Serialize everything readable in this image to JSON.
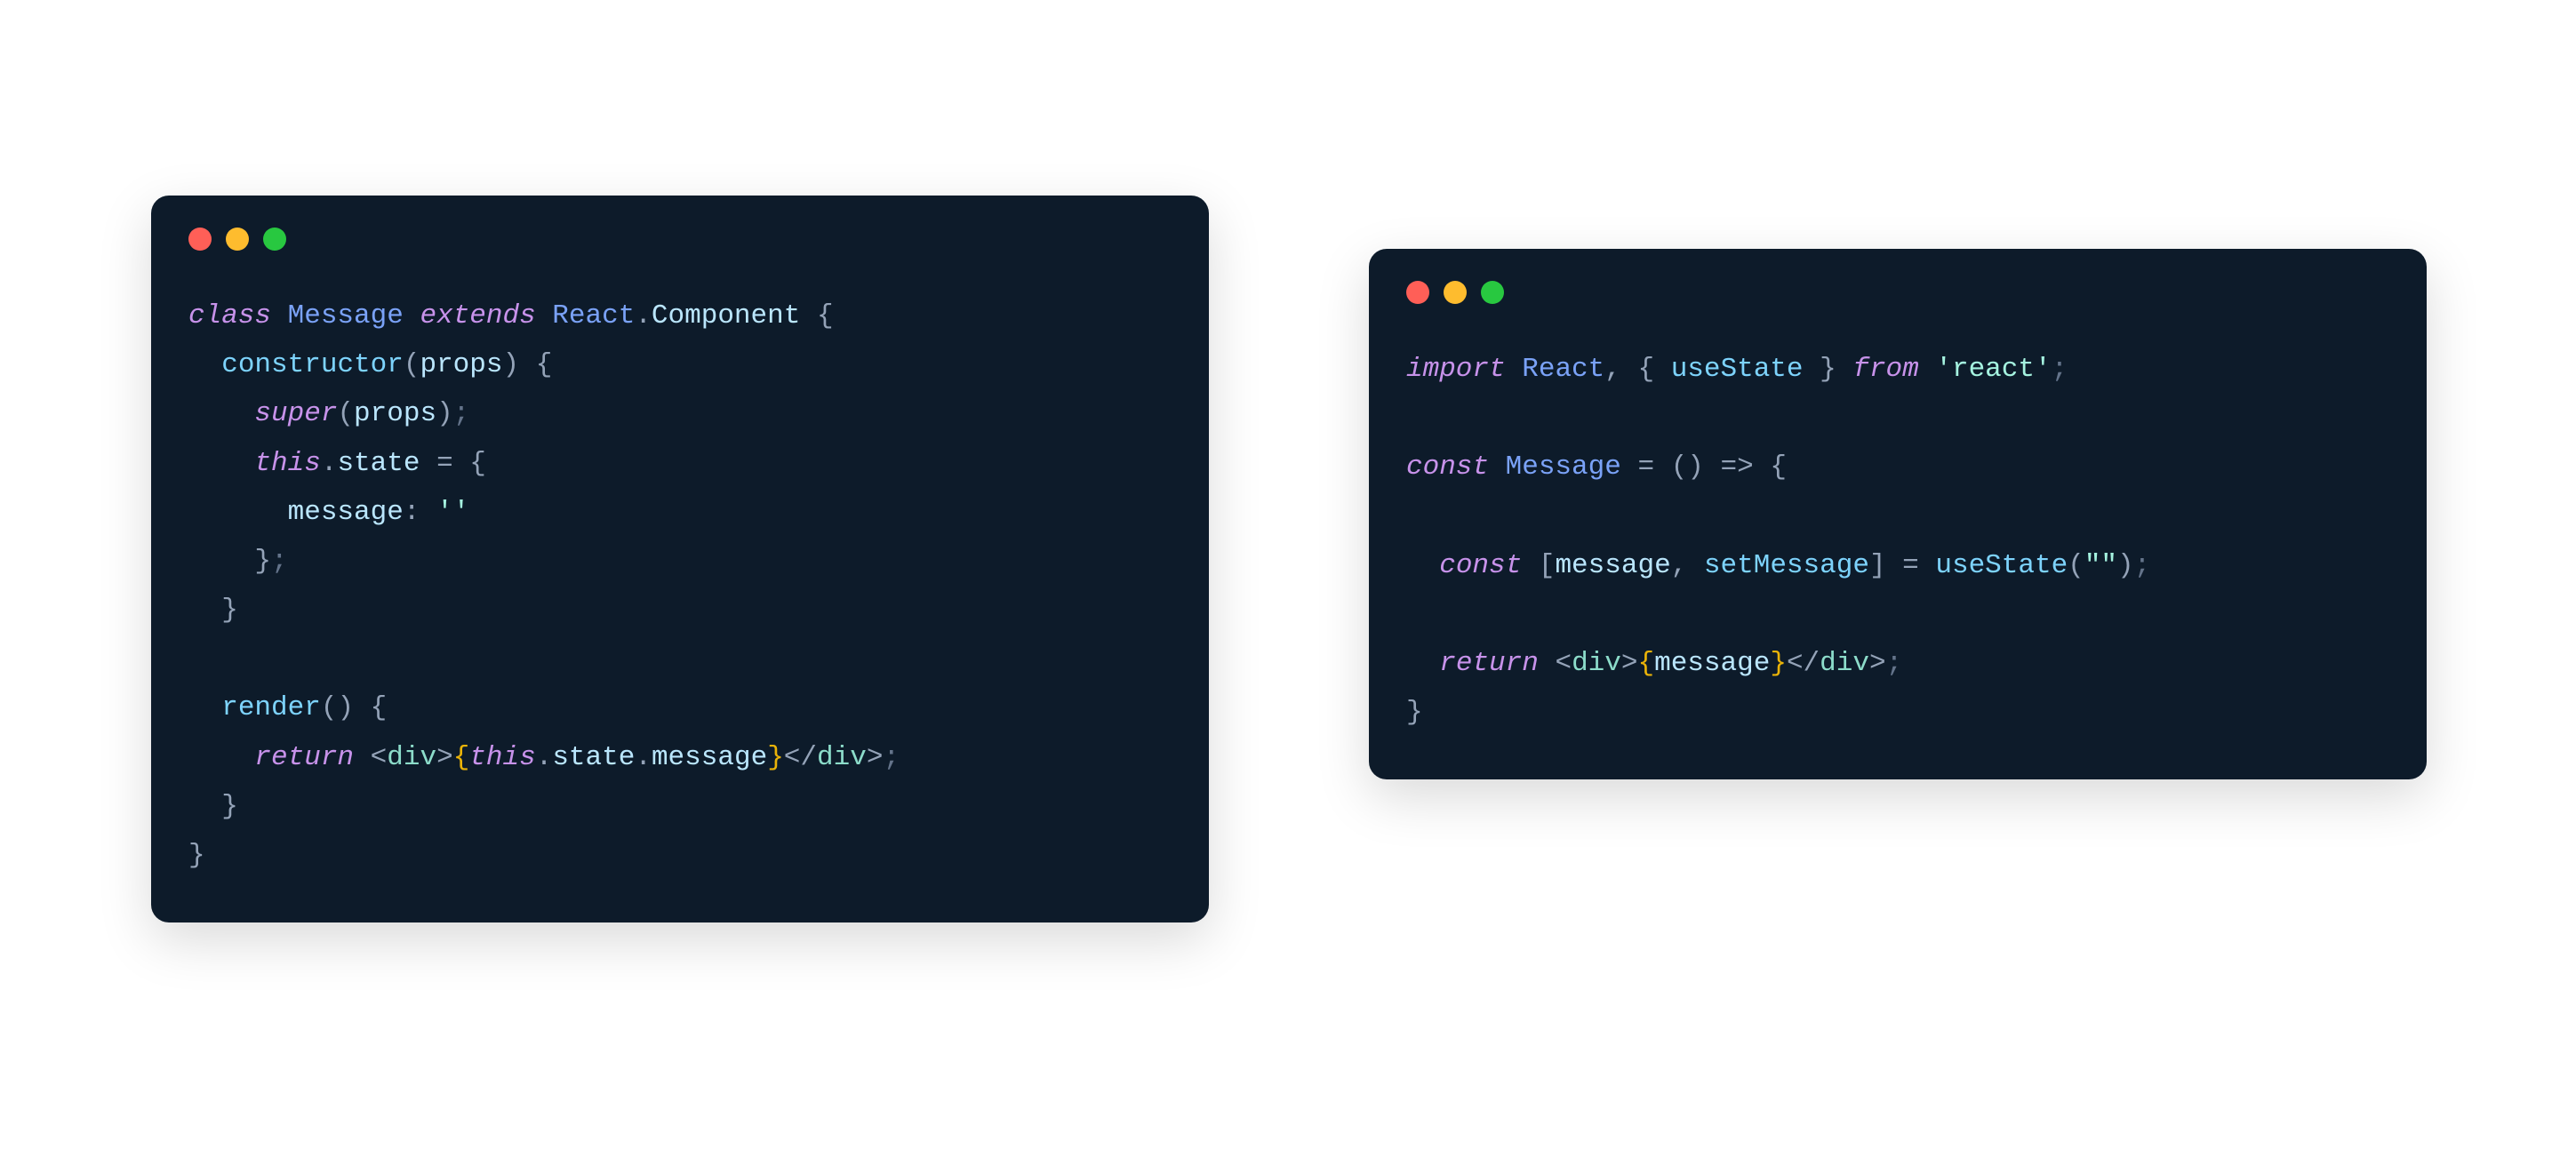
{
  "colors": {
    "window_bg": "#0d1b2a",
    "traffic_red": "#ff5f57",
    "traffic_yellow": "#febc2e",
    "traffic_green": "#28c840"
  },
  "left_code": {
    "tokens": [
      [
        [
          "class ",
          "c-key"
        ],
        [
          "Message",
          "c-type"
        ],
        [
          " ",
          "c-plain"
        ],
        [
          "extends ",
          "c-key"
        ],
        [
          "React",
          "c-type"
        ],
        [
          ".",
          "c-punc"
        ],
        [
          "Component",
          "c-prop"
        ],
        [
          " ",
          "c-plain"
        ],
        [
          "{",
          "c-punc"
        ]
      ],
      [
        [
          "  ",
          "c-plain"
        ],
        [
          "constructor",
          "c-func"
        ],
        [
          "(",
          "c-punc"
        ],
        [
          "props",
          "c-prop"
        ],
        [
          ")",
          "c-punc"
        ],
        [
          " ",
          "c-plain"
        ],
        [
          "{",
          "c-punc"
        ]
      ],
      [
        [
          "    ",
          "c-plain"
        ],
        [
          "super",
          "c-key"
        ],
        [
          "(",
          "c-punc"
        ],
        [
          "props",
          "c-prop"
        ],
        [
          ")",
          "c-punc"
        ],
        [
          ";",
          "c-punc2"
        ]
      ],
      [
        [
          "    ",
          "c-plain"
        ],
        [
          "this",
          "c-key"
        ],
        [
          ".",
          "c-punc"
        ],
        [
          "state",
          "c-prop"
        ],
        [
          " ",
          "c-plain"
        ],
        [
          "=",
          "c-punc"
        ],
        [
          " ",
          "c-plain"
        ],
        [
          "{",
          "c-punc"
        ]
      ],
      [
        [
          "      ",
          "c-plain"
        ],
        [
          "message",
          "c-prop"
        ],
        [
          ":",
          "c-punc"
        ],
        [
          " ",
          "c-plain"
        ],
        [
          "''",
          "c-str"
        ]
      ],
      [
        [
          "    ",
          "c-plain"
        ],
        [
          "}",
          "c-punc"
        ],
        [
          ";",
          "c-punc2"
        ]
      ],
      [
        [
          "  ",
          "c-plain"
        ],
        [
          "}",
          "c-punc"
        ]
      ],
      [
        [
          "",
          "c-plain"
        ]
      ],
      [
        [
          "  ",
          "c-plain"
        ],
        [
          "render",
          "c-func"
        ],
        [
          "(",
          "c-punc"
        ],
        [
          ")",
          "c-punc"
        ],
        [
          " ",
          "c-plain"
        ],
        [
          "{",
          "c-punc"
        ]
      ],
      [
        [
          "    ",
          "c-plain"
        ],
        [
          "return ",
          "c-key"
        ],
        [
          "<",
          "c-punc"
        ],
        [
          "div",
          "c-tag"
        ],
        [
          ">",
          "c-punc"
        ],
        [
          "{",
          "c-brace"
        ],
        [
          "this",
          "c-key"
        ],
        [
          ".",
          "c-punc"
        ],
        [
          "state",
          "c-prop"
        ],
        [
          ".",
          "c-punc"
        ],
        [
          "message",
          "c-prop"
        ],
        [
          "}",
          "c-brace"
        ],
        [
          "</",
          "c-punc"
        ],
        [
          "div",
          "c-tag"
        ],
        [
          ">",
          "c-punc"
        ],
        [
          ";",
          "c-punc2"
        ]
      ],
      [
        [
          "  ",
          "c-plain"
        ],
        [
          "}",
          "c-punc"
        ]
      ],
      [
        [
          "}",
          "c-punc"
        ]
      ]
    ]
  },
  "right_code": {
    "tokens": [
      [
        [
          "import ",
          "c-key"
        ],
        [
          "React",
          "c-type"
        ],
        [
          ",",
          "c-punc"
        ],
        [
          " ",
          "c-plain"
        ],
        [
          "{",
          "c-punc"
        ],
        [
          " ",
          "c-plain"
        ],
        [
          "useState",
          "c-func"
        ],
        [
          " ",
          "c-plain"
        ],
        [
          "}",
          "c-punc"
        ],
        [
          " ",
          "c-plain"
        ],
        [
          "from ",
          "c-key"
        ],
        [
          "'react'",
          "c-str"
        ],
        [
          ";",
          "c-punc2"
        ]
      ],
      [
        [
          "",
          "c-plain"
        ]
      ],
      [
        [
          "const ",
          "c-key"
        ],
        [
          "Message",
          "c-type"
        ],
        [
          " ",
          "c-plain"
        ],
        [
          "=",
          "c-punc"
        ],
        [
          " ",
          "c-plain"
        ],
        [
          "(",
          "c-punc"
        ],
        [
          ")",
          "c-punc"
        ],
        [
          " ",
          "c-plain"
        ],
        [
          "=>",
          "c-punc"
        ],
        [
          " ",
          "c-plain"
        ],
        [
          "{",
          "c-punc"
        ]
      ],
      [
        [
          "",
          "c-plain"
        ]
      ],
      [
        [
          "  ",
          "c-plain"
        ],
        [
          "const ",
          "c-key"
        ],
        [
          "[",
          "c-punc"
        ],
        [
          "message",
          "c-prop"
        ],
        [
          ",",
          "c-punc"
        ],
        [
          " ",
          "c-plain"
        ],
        [
          "setMessage",
          "c-func"
        ],
        [
          "]",
          "c-punc"
        ],
        [
          " ",
          "c-plain"
        ],
        [
          "=",
          "c-punc"
        ],
        [
          " ",
          "c-plain"
        ],
        [
          "useState",
          "c-func"
        ],
        [
          "(",
          "c-punc"
        ],
        [
          "\"\"",
          "c-str"
        ],
        [
          ")",
          "c-punc"
        ],
        [
          ";",
          "c-punc2"
        ]
      ],
      [
        [
          "",
          "c-plain"
        ]
      ],
      [
        [
          "  ",
          "c-plain"
        ],
        [
          "return ",
          "c-key"
        ],
        [
          "<",
          "c-punc"
        ],
        [
          "div",
          "c-tag"
        ],
        [
          ">",
          "c-punc"
        ],
        [
          "{",
          "c-brace"
        ],
        [
          "message",
          "c-prop"
        ],
        [
          "}",
          "c-brace"
        ],
        [
          "</",
          "c-punc"
        ],
        [
          "div",
          "c-tag"
        ],
        [
          ">",
          "c-punc"
        ],
        [
          ";",
          "c-punc2"
        ]
      ],
      [
        [
          "}",
          "c-punc"
        ]
      ]
    ]
  }
}
